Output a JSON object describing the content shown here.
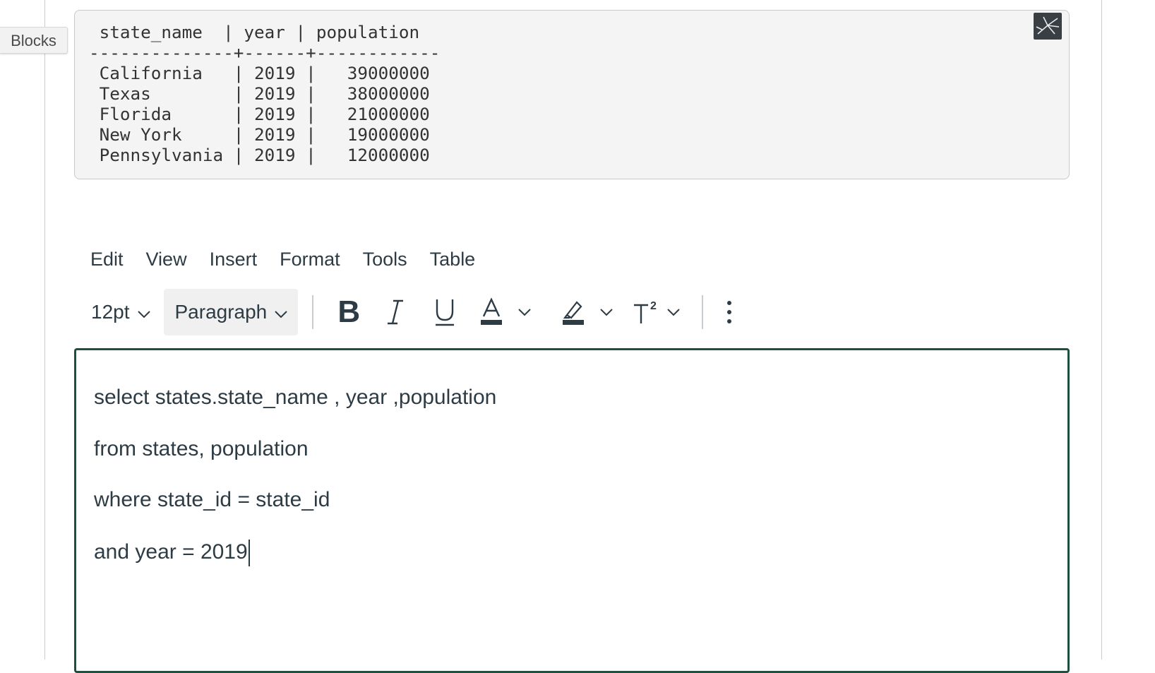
{
  "blocks_tab": {
    "label": "Blocks"
  },
  "query_result": {
    "text": " state_name  | year | population\n--------------+------+------------\n California   | 2019 |   39000000\n Texas        | 2019 |   38000000\n Florida      | 2019 |   21000000\n New York     | 2019 |   19000000\n Pennsylvania | 2019 |   12000000"
  },
  "menubar": {
    "items": [
      "Edit",
      "View",
      "Insert",
      "Format",
      "Tools",
      "Table"
    ]
  },
  "toolbar": {
    "font_size": "12pt",
    "block_format": "Paragraph",
    "bold_label": "B"
  },
  "editor": {
    "lines": [
      "select states.state_name , year ,population",
      "from states, population",
      "where state_id = state_id",
      "and year = 2019"
    ]
  },
  "colors": {
    "text": "#2d3b45",
    "editor_focus_border": "#1f4f3f",
    "code_background": "#f4f4f4"
  }
}
